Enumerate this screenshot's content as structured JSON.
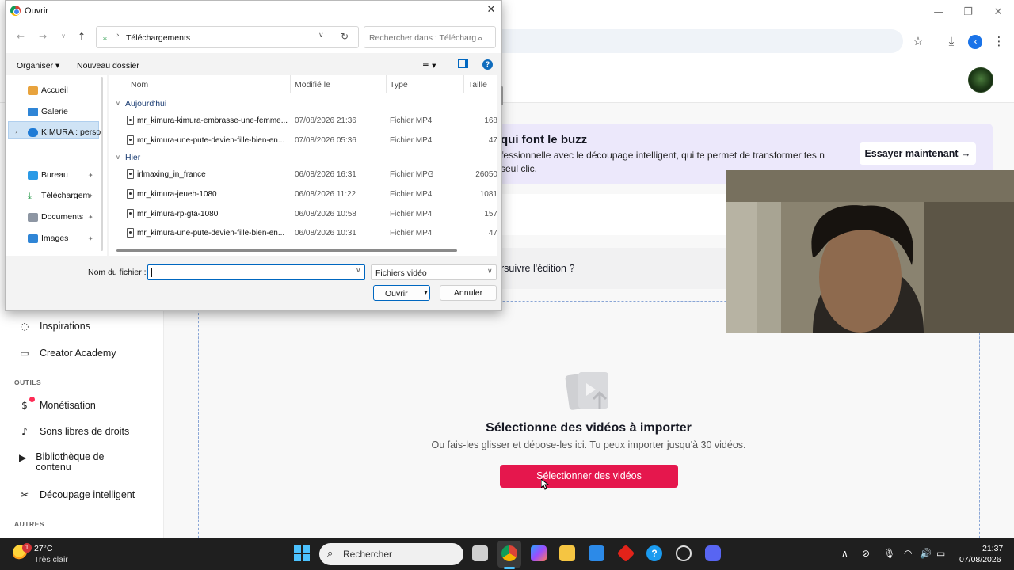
{
  "browser": {
    "minimize": "—",
    "restore": "❐",
    "close": "✕",
    "profile_initial": "k",
    "icons": [
      "star-icon",
      "download-icon",
      "profile-icon",
      "menu-icon"
    ]
  },
  "promo": {
    "title": "qui font le buzz",
    "description": "fessionnelle avec le découpage intelligent, qui te permet de transformer tes n seul clic.",
    "cta": "Essayer maintenant →"
  },
  "continue_prompt": "rsuivre l'édition ?",
  "sidebar": {
    "items_top": [
      {
        "label": "Inspirations",
        "icon": "lightbulb-icon"
      },
      {
        "label": "Creator Academy",
        "icon": "academy-icon"
      }
    ],
    "section_tools": "OUTILS",
    "items_tools": [
      {
        "label": "Monétisation",
        "icon": "dollar-icon"
      },
      {
        "label": "Sons libres de droits",
        "icon": "music-note-icon"
      },
      {
        "label": "Bibliothèque de contenu",
        "icon": "library-icon"
      },
      {
        "label": "Découpage intelligent",
        "icon": "smart-cut-icon"
      }
    ],
    "section_other": "AUTRES"
  },
  "upload": {
    "title": "Sélectionne des vidéos à importer",
    "subtitle": "Ou fais-les glisser et dépose-les ici. Tu peux importer jusqu'à 30 vidéos.",
    "button": "Sélectionner des vidéos"
  },
  "dialog": {
    "title": "Ouvrir",
    "path": "Téléchargements",
    "search_placeholder": "Rechercher dans : Télécharg...",
    "organize": "Organiser ▾",
    "new_folder": "Nouveau dossier",
    "nav_pane": [
      {
        "label": "Accueil",
        "icon": "home-icon"
      },
      {
        "label": "Galerie",
        "icon": "gallery-icon"
      },
      {
        "label": "KIMURA : perso",
        "icon": "cloud-icon"
      },
      {
        "label": "Bureau",
        "icon": "desktop-icon"
      },
      {
        "label": "Téléchargem",
        "icon": "downloads-icon"
      },
      {
        "label": "Documents",
        "icon": "documents-icon"
      },
      {
        "label": "Images",
        "icon": "images-icon"
      }
    ],
    "columns": {
      "name": "Nom",
      "modified": "Modifié le",
      "type": "Type",
      "size": "Taille"
    },
    "groups": [
      {
        "label": "Aujourd'hui",
        "files": [
          {
            "name": "mr_kimura-kimura-embrasse-une-femme...",
            "date": "07/08/2026 21:36",
            "type": "Fichier MP4",
            "size": "168"
          },
          {
            "name": "mr_kimura-une-pute-devien-fille-bien-en...",
            "date": "07/08/2026 05:36",
            "type": "Fichier MP4",
            "size": "47"
          }
        ]
      },
      {
        "label": "Hier",
        "files": [
          {
            "name": "irlmaxing_in_france",
            "date": "06/08/2026 16:31",
            "type": "Fichier MPG",
            "size": "26050"
          },
          {
            "name": "mr_kimura-jeueh-1080",
            "date": "06/08/2026 11:22",
            "type": "Fichier MP4",
            "size": "1081"
          },
          {
            "name": "mr_kimura-rp-gta-1080",
            "date": "06/08/2026 10:58",
            "type": "Fichier MP4",
            "size": "157"
          },
          {
            "name": "mr_kimura-une-pute-devien-fille-bien-en...",
            "date": "06/08/2026 10:31",
            "type": "Fichier MP4",
            "size": "47"
          }
        ]
      }
    ],
    "filename_label": "Nom du fichier :",
    "filename_value": "",
    "filetype": "Fichiers vidéo",
    "open_button": "Ouvrir",
    "cancel_button": "Annuler"
  },
  "taskbar": {
    "weather_badge": "1",
    "temperature": "27°C",
    "condition": "Très clair",
    "search": "Rechercher",
    "time": "21:37",
    "date": "07/08/2026"
  }
}
